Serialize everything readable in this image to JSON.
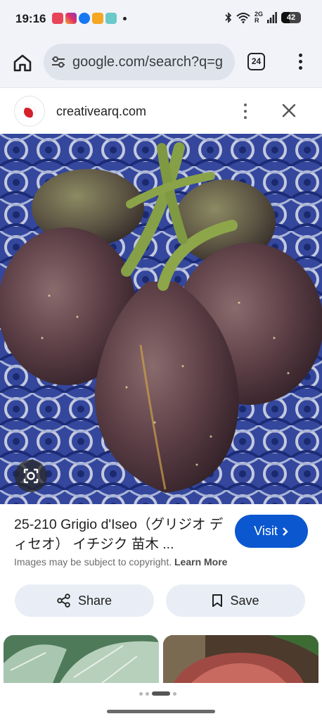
{
  "status_bar": {
    "time": "19:16",
    "network": "2G",
    "roaming": "R",
    "battery": "42",
    "icons": [
      "notification-app-icon",
      "instagram-icon",
      "messenger-icon",
      "app-icon",
      "app-icon",
      "more-notifications-dot",
      "bluetooth-icon",
      "wifi-icon",
      "signal-icon",
      "battery-icon"
    ]
  },
  "browser": {
    "url": "google.com/search?q=g",
    "tab_count": "24",
    "icons": [
      "home-icon",
      "site-settings-icon",
      "more-vert-icon"
    ]
  },
  "site": {
    "name": "creativearq.com",
    "icons": [
      "site-favicon",
      "more-vert-icon",
      "close-icon"
    ]
  },
  "result": {
    "title": "25-210 Grigio d'Iseo（グリジオ ディセオ） イチジク 苗木 ...",
    "visit_label": "Visit",
    "copyright_text": "Images may be subject to copyright.",
    "learn_more": "Learn More",
    "share_label": "Share",
    "save_label": "Save",
    "icons": [
      "google-lens-icon",
      "chevron-right-icon",
      "share-icon",
      "bookmark-icon"
    ]
  },
  "colors": {
    "accent": "#0b57d0",
    "chrome_bg": "#f1f3f8",
    "pill_bg": "#e9eef6"
  }
}
